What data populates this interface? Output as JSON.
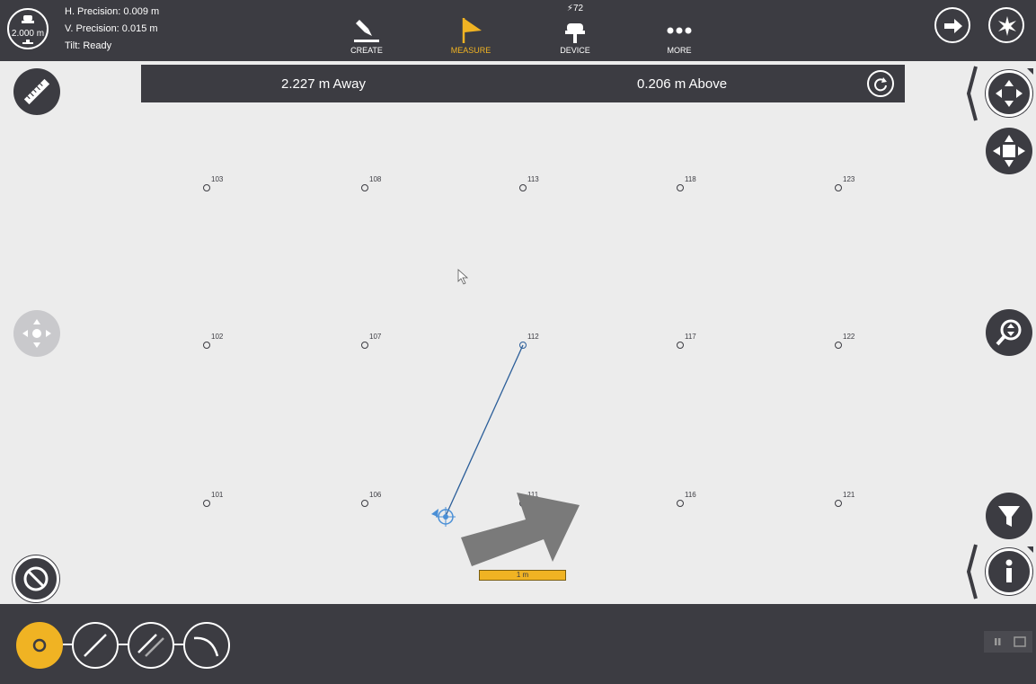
{
  "rod": {
    "height_label": "2.000 m"
  },
  "precision": {
    "h": "H. Precision:  0.009 m",
    "v": "V. Precision:  0.015 m",
    "tilt": "Tilt:  Ready"
  },
  "nav": {
    "create": "CREATE",
    "measure": "MEASURE",
    "device": "DEVICE",
    "device_badge": "⚡72",
    "more": "MORE"
  },
  "banner": {
    "away": "2.227 m Away",
    "above": "0.206 m Above"
  },
  "scale": {
    "label": "1 m"
  },
  "points": [
    {
      "label": "103"
    },
    {
      "label": "108"
    },
    {
      "label": "113"
    },
    {
      "label": "118"
    },
    {
      "label": "123"
    },
    {
      "label": "102"
    },
    {
      "label": "107"
    },
    {
      "label": "112"
    },
    {
      "label": "117"
    },
    {
      "label": "122"
    },
    {
      "label": "101"
    },
    {
      "label": "106"
    },
    {
      "label": "111"
    },
    {
      "label": "116"
    },
    {
      "label": "121"
    }
  ],
  "colors": {
    "accent": "#f0b323",
    "bar": "#3c3c42",
    "map_bg": "#ececec",
    "line": "#2b5e99"
  },
  "icons": {
    "rod": "gnss-rod-icon",
    "create": "pencil-icon",
    "measure": "flag-icon",
    "device": "receiver-icon",
    "more": "dots-icon",
    "next": "arrow-right-icon",
    "star": "sparkle-icon",
    "ruler": "ruler-icon",
    "pan": "pan-icon",
    "move": "move-icon",
    "zoom": "zoom-icon",
    "filter": "filter-icon",
    "info": "info-icon",
    "cancel": "cancel-icon",
    "refresh": "refresh-icon"
  }
}
